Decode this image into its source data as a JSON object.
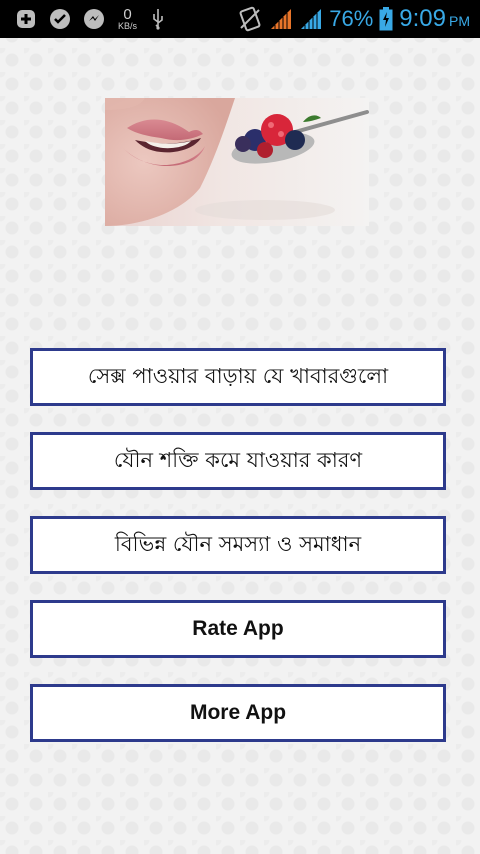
{
  "status_bar": {
    "net_speed_value": "0",
    "net_speed_unit": "KB/s",
    "battery_percent": "76%",
    "time": "9:09",
    "ampm": "PM",
    "icons": [
      "add-box-icon",
      "check-circle-icon",
      "messenger-icon",
      "net-speed-meter",
      "usb-icon",
      "no-sim-icon",
      "signal-icon",
      "signal-icon",
      "battery-charging-icon"
    ],
    "colors": {
      "accent": "#39a9e6",
      "signal": "#e8752a"
    }
  },
  "hero": {
    "image": "lips-and-berry-spoon-photo"
  },
  "menu": {
    "items": [
      {
        "label": "সেক্স পাওয়ার বাড়ায় যে খাবারগুলো"
      },
      {
        "label": "যৌন শক্তি কমে যাওয়ার কারণ"
      },
      {
        "label": "বিভিন্ন যৌন সমস্যা ও সমাধান"
      },
      {
        "label": "Rate App"
      },
      {
        "label": "More App"
      }
    ],
    "border_color": "#2d3a8c"
  }
}
